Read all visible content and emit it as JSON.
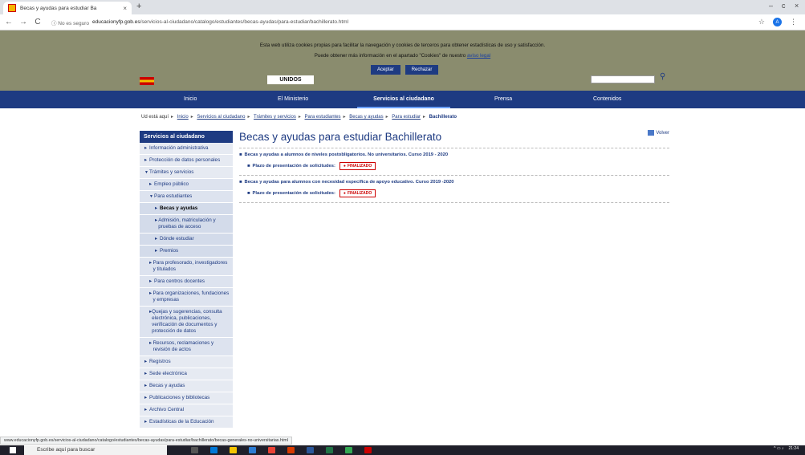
{
  "browser": {
    "tab_title": "Becas y ayudas para estudiar Ba",
    "tab_close": "×",
    "new_tab": "+",
    "win_min": "–",
    "win_restore": "c",
    "win_close": "×",
    "back": "←",
    "forward": "→",
    "reload": "C",
    "insecure_label": "ⓘ No es seguro",
    "url_host": "educacionyfp.gob.es",
    "url_path": "/servicios-al-ciudadano/catalogo/estudiantes/becas-ayudas/para-estudiar/bachillerato.html",
    "star": "☆",
    "avatar_letter": "A",
    "menu": "⋮"
  },
  "cookie": {
    "line1": "Esta web utiliza cookies propias para facilitar la navegación y cookies de terceros para obtener estadísticas de uso y satisfacción.",
    "line2_prefix": "Puede obtener más información en el apartado \"Cookies\" de nuestro ",
    "line2_link": "aviso legal",
    "accept": "Aceptar",
    "reject": "Rechazar"
  },
  "header": {
    "unidos": "UNIDOS"
  },
  "nav": {
    "items": [
      "Inicio",
      "El Ministerio",
      "Servicios al ciudadano",
      "Prensa",
      "Contenidos"
    ]
  },
  "breadcrumb": {
    "prefix": "Ud está aquí",
    "links": [
      "Inicio",
      "Servicios al ciudadano",
      "Trámites y servicios",
      "Para estudiantes",
      "Becas y ayudas",
      "Para estudiar"
    ],
    "current": "Bachillerato"
  },
  "sidebar": {
    "heading": "Servicios al ciudadano",
    "items": [
      {
        "label": "Información administrativa"
      },
      {
        "label": "Protección de datos personales"
      },
      {
        "label": "Trámites y servicios"
      },
      {
        "label": "Empleo público"
      },
      {
        "label": "Para estudiantes"
      },
      {
        "label": "Becas y ayudas"
      },
      {
        "label": "Admisión, matriculación y pruebas de acceso"
      },
      {
        "label": "Dónde estudiar"
      },
      {
        "label": "Premios"
      },
      {
        "label": "Para profesorado, investigadores y titulados"
      },
      {
        "label": "Para centros docentes"
      },
      {
        "label": "Para organizaciones, fundaciones y empresas"
      },
      {
        "label": "Quejas y sugerencias, consulta electrónica, publicaciones, verificación de documentos y protección de datos"
      },
      {
        "label": "Recursos, reclamaciones y revisión de actos"
      },
      {
        "label": "Registros"
      },
      {
        "label": "Sede electrónica"
      },
      {
        "label": "Becas y ayudas"
      },
      {
        "label": "Publicaciones y bibliotecas"
      },
      {
        "label": "Archivo Central"
      },
      {
        "label": "Estadísticas de la Educación"
      }
    ]
  },
  "main": {
    "title": "Becas y ayudas para estudiar Bachillerato",
    "volver": "Volver",
    "entries": [
      {
        "title": "Becas y ayudas a alumnos de niveles postobligatorios. No universitarios. Curso 2019 - 2020",
        "plazo_label": "Plazo de presentación de solicitudes:",
        "status": "FINALIZADO"
      },
      {
        "title": "Becas y ayudas para alumnos con necesidad específica de apoyo educativo. Curso 2019 -2020",
        "plazo_label": "Plazo de presentación de solicitudes:",
        "status": "FINALIZADO"
      }
    ]
  },
  "status_bar": {
    "url": "www.educacionyfp.gob.es/servicios-al-ciudadano/catalogo/estudiantes/becas-ayudas/para-estudiar/bachillerato/becas-generales-no-universitarias.html"
  },
  "taskbar": {
    "search_placeholder": "Escribe aquí para buscar",
    "time": "21:24"
  }
}
